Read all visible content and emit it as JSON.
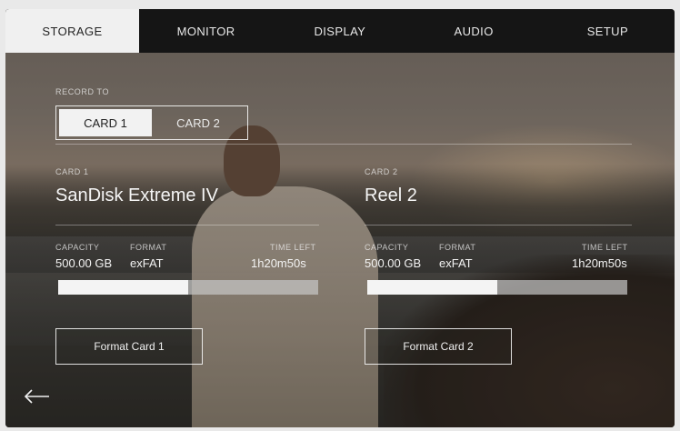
{
  "tabs": [
    {
      "label": "STORAGE",
      "active": true
    },
    {
      "label": "MONITOR",
      "active": false
    },
    {
      "label": "DISPLAY",
      "active": false
    },
    {
      "label": "AUDIO",
      "active": false
    },
    {
      "label": "SETUP",
      "active": false
    }
  ],
  "record_to": {
    "label": "RECORD TO",
    "options": [
      "CARD 1",
      "CARD 2"
    ],
    "selected": "CARD 1"
  },
  "cards": [
    {
      "slot_label": "CARD 1",
      "name": "SanDisk Extreme IV",
      "capacity_label": "CAPACITY",
      "capacity": "500.00 GB",
      "format_label": "FORMAT",
      "format": "exFAT",
      "time_left_label": "TIME LEFT",
      "time_left": "1h20m50s",
      "used_fraction": 0.5,
      "format_button": "Format Card 1"
    },
    {
      "slot_label": "CARD 2",
      "name": "Reel 2",
      "capacity_label": "CAPACITY",
      "capacity": "500.00 GB",
      "format_label": "FORMAT",
      "format": "exFAT",
      "time_left_label": "TIME LEFT",
      "time_left": "1h20m50s",
      "used_fraction": 0.5,
      "format_button": "Format Card 2"
    }
  ],
  "colors": {
    "tab_active_bg": "#f0f0f0",
    "tab_bar_bg": "#151515",
    "bar_fill": "#f4f4f4"
  },
  "icons": {
    "back": "arrow-left-icon"
  }
}
